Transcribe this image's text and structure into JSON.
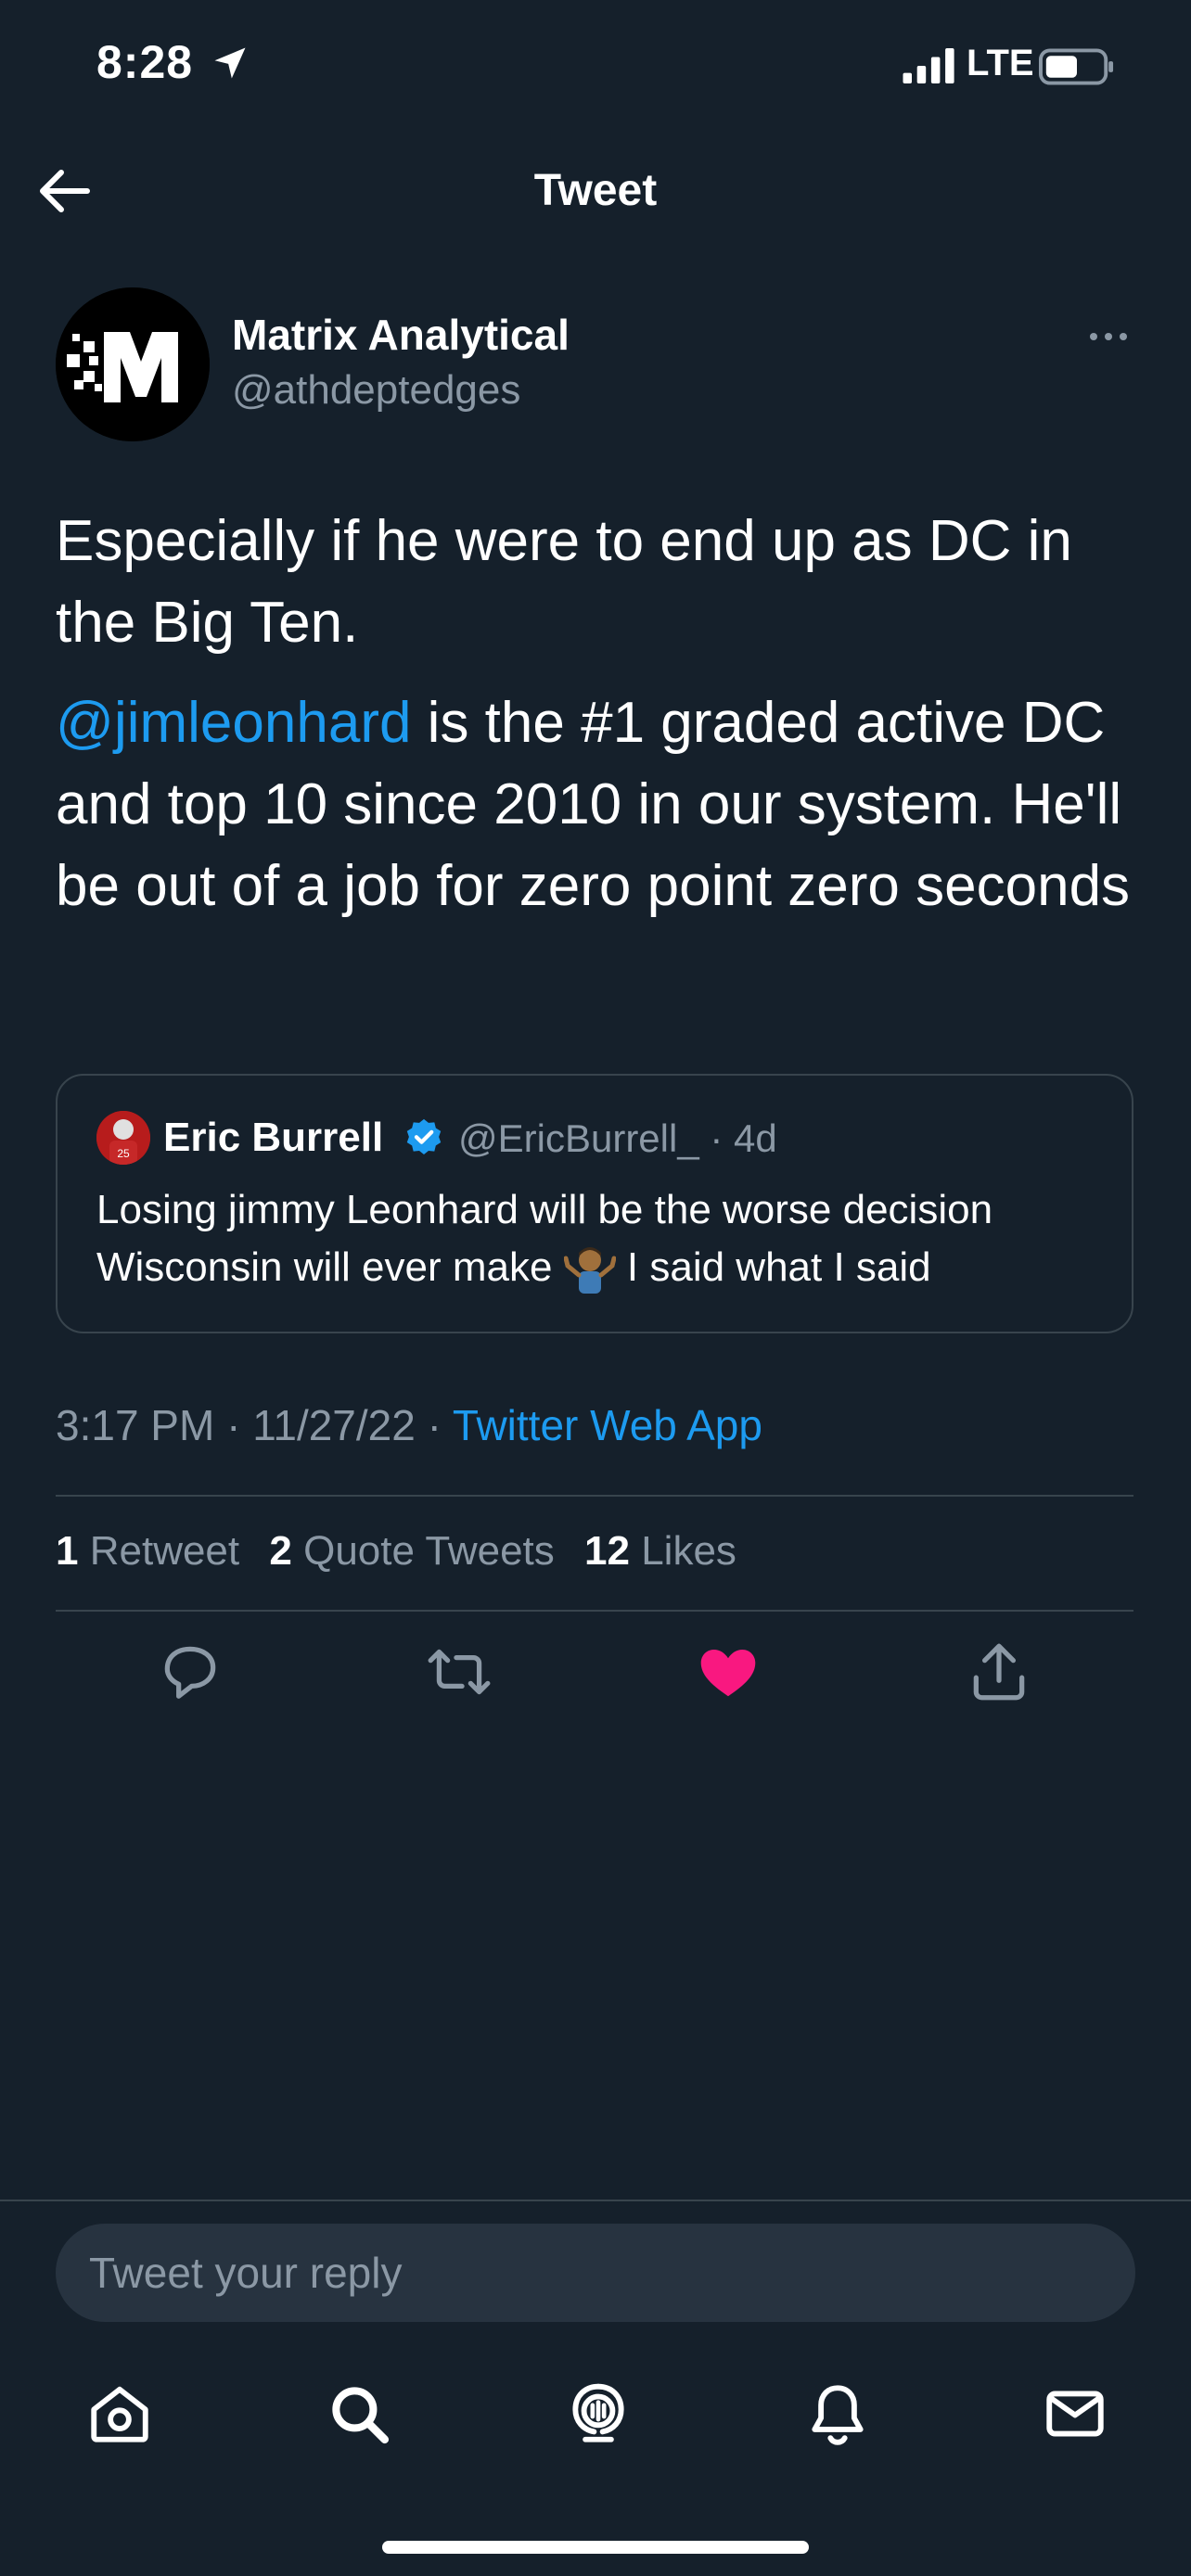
{
  "status_bar": {
    "time": "8:28",
    "network": "LTE"
  },
  "header": {
    "title": "Tweet"
  },
  "tweet": {
    "author_name": "Matrix Analytical",
    "author_handle": "@athdeptedges",
    "paragraph1": "Especially if he were to end up as DC in the Big Ten.",
    "mention": "@jimleonhard",
    "paragraph2_rest": " is the #1 graded active DC and top 10 since 2010 in our system. He'll be out of a job for zero point zero seconds",
    "time": "3:17 PM · 11/27/22 · ",
    "client": "Twitter Web App"
  },
  "quoted_tweet": {
    "author_name": "Eric Burrell",
    "meta": "@EricBurrell_ · 4d",
    "text_before_emoji": "Losing jimmy Leonhard will be the worse decision Wisconsin will ever make ",
    "text_after_emoji": " I said what I said"
  },
  "stats": {
    "retweets_count": "1",
    "retweets_label": "Retweet",
    "quotes_count": "2",
    "quotes_label": "Quote Tweets",
    "likes_count": "12",
    "likes_label": "Likes"
  },
  "reply": {
    "placeholder": "Tweet your reply"
  },
  "colors": {
    "background": "#15202b",
    "accent": "#1d9bf0",
    "like": "#f91880",
    "muted": "#8b98a5",
    "divider": "#38444d"
  },
  "icons": [
    "location-arrow-icon",
    "signal-icon",
    "battery-icon",
    "back-arrow-icon",
    "more-icon",
    "verified-icon",
    "reply-icon",
    "retweet-icon",
    "like-icon",
    "share-icon",
    "home-icon",
    "search-icon",
    "spaces-icon",
    "notifications-icon",
    "messages-icon"
  ]
}
